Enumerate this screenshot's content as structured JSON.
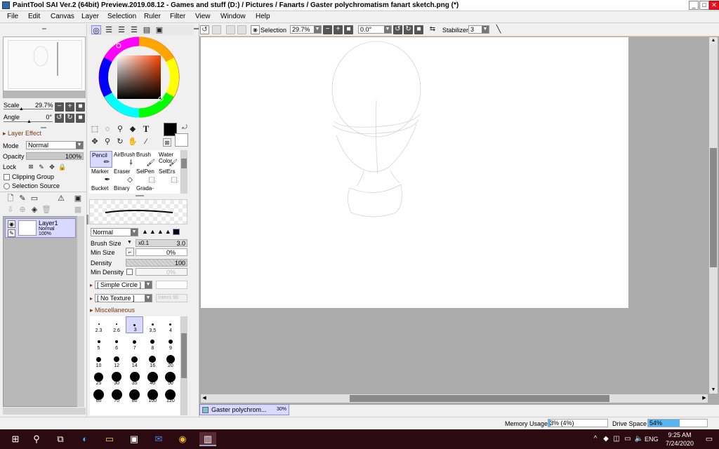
{
  "window": {
    "title": "PaintTool SAI Ver.2 (64bit) Preview.2019.08.12 - Games and stuff (D:) / Pictures / Fanarts / Gaster polychromatism fanart sketch.png (*)",
    "minimize": "_",
    "maximize": "□",
    "close": "✕"
  },
  "menu": [
    "File",
    "Edit",
    "Canvas",
    "Layer",
    "Selection",
    "Ruler",
    "Filter",
    "View",
    "Window",
    "Help"
  ],
  "toolbar": {
    "selection_label": "Selection",
    "zoom": "29.7%",
    "angle": "0.0°",
    "stabilizer_label": "Stabilizer",
    "stabilizer_value": "3"
  },
  "navigator": {
    "scale_label": "Scale",
    "scale_value": "29.7%",
    "angle_label": "Angle",
    "angle_value": "0°"
  },
  "layer_panel": {
    "section_title": "Layer Effect",
    "mode_label": "Mode",
    "mode_value": "Normal",
    "opacity_label": "Opacity",
    "opacity_value": "100%",
    "lock_label": "Lock",
    "clipping_label": "Clipping Group",
    "selection_source_label": "Selection Source",
    "layers": [
      {
        "name": "Layer1",
        "mode": "Normal",
        "opacity": "100%"
      }
    ]
  },
  "tools": [
    {
      "label": "Pencil",
      "icon": "pencil-icon",
      "selected": true
    },
    {
      "label": "AirBrush",
      "icon": "airbrush-icon",
      "selected": false
    },
    {
      "label": "Brush",
      "icon": "brush-icon",
      "selected": false
    },
    {
      "label": "Water Color",
      "icon": "watercolor-icon",
      "selected": false
    },
    {
      "label": "Marker",
      "icon": "marker-icon",
      "selected": false
    },
    {
      "label": "Eraser",
      "icon": "eraser-icon",
      "selected": false
    },
    {
      "label": "SelPen",
      "icon": "selpen-icon",
      "selected": false
    },
    {
      "label": "SelErs",
      "icon": "selers-icon",
      "selected": false
    },
    {
      "label": "Bucket",
      "icon": "bucket-icon",
      "selected": false
    },
    {
      "label": "Binary",
      "icon": "binary-icon",
      "selected": false
    },
    {
      "label": "Grada-",
      "icon": "gradation-icon",
      "selected": false
    }
  ],
  "brush": {
    "blend_mode": "Normal",
    "size_label": "Brush Size",
    "size_multiplier": "x0.1",
    "size_value": "3.0",
    "min_size_label": "Min Size",
    "min_size_value": "0%",
    "density_label": "Density",
    "density_value": "100",
    "min_density_label": "Min Density",
    "min_density_value": "0%",
    "shape": "[ Simple Circle ]",
    "texture": "[ No Texture ]",
    "texture_intensity": "Intens 95",
    "misc_label": "Miscellaneous"
  },
  "brush_sizes": [
    "2.3",
    "2.6",
    "3",
    "3.5",
    "4",
    "5",
    "6",
    "7",
    "8",
    "9",
    "10",
    "12",
    "14",
    "16",
    "20",
    "25",
    "30",
    "35",
    "40",
    "50",
    "60",
    "70",
    "80",
    "100",
    "120"
  ],
  "selected_brush_size": "3",
  "document_tab": {
    "name": "Gaster polychrom...",
    "zoom": "30%"
  },
  "status": {
    "memory_label": "Memory Usage",
    "memory_value": "3% (4%)",
    "memory_fraction": 0.03,
    "drive_label": "Drive Space",
    "drive_value": "54%",
    "drive_fraction": 0.54
  },
  "taskbar": {
    "time": "9:25 AM",
    "date": "7/24/2020",
    "language": "ENG"
  },
  "colors": {
    "accent": "#5ab4f0",
    "selection_bg": "#d9d9ff",
    "section_text": "#7a3a10",
    "canvas_bg": "#ababab",
    "taskbar_bg": "#2b0a12"
  }
}
